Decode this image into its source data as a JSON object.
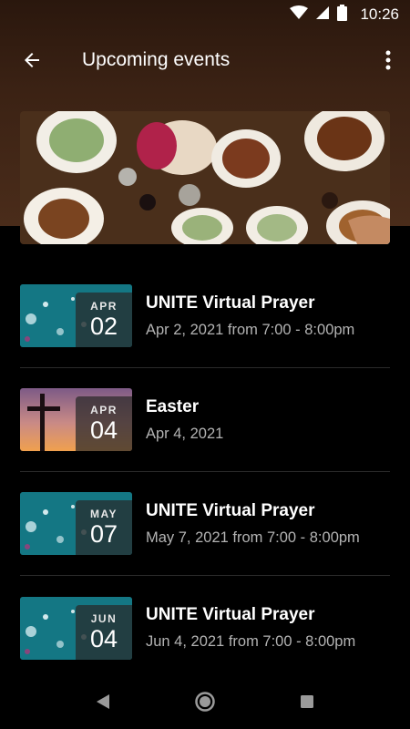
{
  "status_bar": {
    "time": "10:26"
  },
  "app_bar": {
    "title": "Upcoming events"
  },
  "events": [
    {
      "month": "APR",
      "day": "02",
      "title": "UNITE Virtual Prayer",
      "subtitle": "Apr 2, 2021 from 7:00 - 8:00pm",
      "thumbnail": "teal-bokeh"
    },
    {
      "month": "APR",
      "day": "04",
      "title": "Easter",
      "subtitle": "Apr 4, 2021",
      "thumbnail": "cross-sunset"
    },
    {
      "month": "MAY",
      "day": "07",
      "title": "UNITE Virtual Prayer",
      "subtitle": "May 7, 2021 from 7:00 - 8:00pm",
      "thumbnail": "teal-bokeh"
    },
    {
      "month": "JUN",
      "day": "04",
      "title": "UNITE Virtual Prayer",
      "subtitle": "Jun 4, 2021 from 7:00 - 8:00pm",
      "thumbnail": "teal-bokeh"
    }
  ],
  "colors": {
    "header_brown": "#3b2214",
    "background": "#000000",
    "subtitle_gray": "#b3b3b3",
    "teal": "#1b8f9a"
  }
}
